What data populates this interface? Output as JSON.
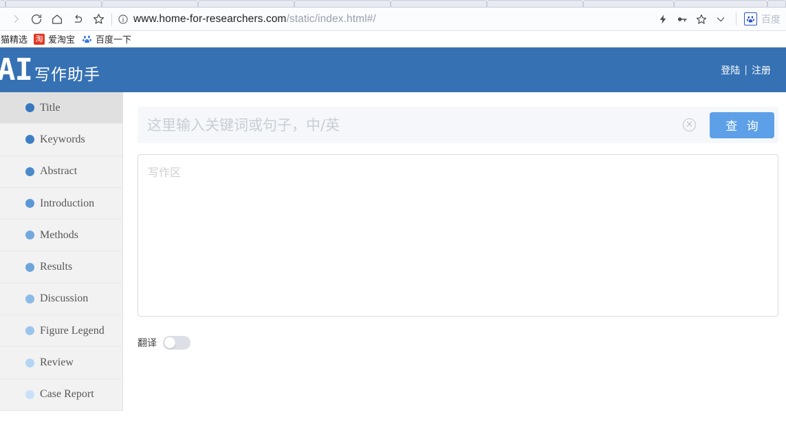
{
  "browser": {
    "tab_count": 10,
    "nav_icons": [
      "forward-icon",
      "reload-icon",
      "home-icon",
      "back-arrow-icon",
      "bookmark-star-icon"
    ],
    "url": {
      "domain": "www.home-for-researchers.com",
      "path": "/static/index.html#/",
      "info_icon": "site-info-icon"
    },
    "toolbar_right_icons": [
      "lightning-icon",
      "key-icon",
      "star-icon",
      "chevron-down-icon"
    ],
    "baidu_extension": {
      "icon": "baidu-paw-icon",
      "label": "百度"
    },
    "bookmarks": [
      {
        "icon": "",
        "label": "天猫精选"
      },
      {
        "icon": "taobao-icon",
        "icon_text": "淘",
        "label": "爱淘宝"
      },
      {
        "icon": "baidu-paw-icon",
        "label": "百度一下"
      }
    ]
  },
  "header": {
    "logo_mark": "AI",
    "logo_text": "写作助手",
    "login_label": "登陆",
    "separator": "|",
    "register_label": "注册",
    "background_color": "#3671b4"
  },
  "sidebar": {
    "items": [
      {
        "label": "Title",
        "dot_color": "#3677bd",
        "active": true
      },
      {
        "label": "Keywords",
        "dot_color": "#3d7fc3",
        "active": false
      },
      {
        "label": "Abstract",
        "dot_color": "#4b8bcc",
        "active": false
      },
      {
        "label": "Introduction",
        "dot_color": "#5d98d6",
        "active": false
      },
      {
        "label": "Methods",
        "dot_color": "#73a8de",
        "active": false
      },
      {
        "label": "Results",
        "dot_color": "#6fa5dd",
        "active": false
      },
      {
        "label": "Discussion",
        "dot_color": "#8cbae7",
        "active": false
      },
      {
        "label": "Figure Legend",
        "dot_color": "#9cc5ec",
        "active": false
      },
      {
        "label": "Review",
        "dot_color": "#b4d4f3",
        "active": false
      },
      {
        "label": "Case Report",
        "dot_color": "#c9e0f8",
        "active": false
      }
    ]
  },
  "main": {
    "search": {
      "value": "",
      "placeholder": "这里输入关键词或句子，中/英",
      "clear_icon": "clear-circle-icon",
      "button_label": "查 询",
      "button_color": "#5da0e8"
    },
    "editor": {
      "value": "",
      "placeholder": "写作区"
    },
    "translate_toggle": {
      "label": "翻译",
      "state": "off"
    }
  }
}
